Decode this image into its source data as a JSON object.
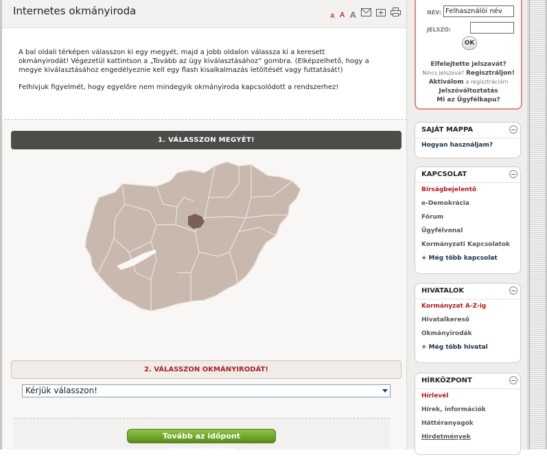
{
  "header": {
    "title": "Internetes okmányiroda",
    "tools": {
      "font_small": "A",
      "font_medium": "A",
      "font_large": "A"
    }
  },
  "intro": {
    "p1": "A bal oldali térképen válasszon ki egy megyét, majd a jobb oldalon válassza ki a keresett okmányirodát! Végezetül kattintson a „Tovább az ügy kiválasztásához” gombra. (Elképzelhető, hogy a megye kiválasztásához engedélyeznie kell egy flash kisalkalmazás letöltését vagy futtatását!)",
    "p2": "Felhívjuk figyelmét, hogy egyelőre nem mindegyik okmányiroda kapcsolódott a rendszerhez!"
  },
  "step1": "1. VÁLASSZON MEGYÉT!",
  "step2": "2. VÁLASSZON OKMÁNYIRODÁT!",
  "select": {
    "value": "Kérjük válasszon!"
  },
  "continue_button": "Tovább az időpont kiválasztásához",
  "colors": {
    "map_fill": "#c8b8ad",
    "map_selected": "#7a6055",
    "step1_bg": "#4e4c49",
    "accent_red": "#a62222",
    "button_green": "#6fa52b"
  },
  "login": {
    "name_label": "NÉV:",
    "name_value": "Felhasználói név",
    "password_label": "JELSZÓ:",
    "ok": "OK",
    "forgot": "Elfelejtette jelszavát?",
    "no_pass_prefix": "Nincs jelszava?",
    "register": "Regisztráljon!",
    "activate": "Aktiválom",
    "activate_suffix": "a regisztrációm",
    "change_pass": "Jelszóváltoztatás",
    "what_is": "Mi az Ügyfélkapu?"
  },
  "boxes": {
    "own_folder": {
      "title": "SAJÁT MAPPA",
      "items": [
        "Hogyan használjam?"
      ]
    },
    "contact": {
      "title": "KAPCSOLAT",
      "items": [
        "Bírságbejelentő",
        "e-Demokrácia",
        "Fórum",
        "Ügyfélvonal",
        "Kormányzati Kapcsolatok",
        "+ Még több kapcsolat"
      ]
    },
    "offices": {
      "title": "HIVATALOK",
      "items": [
        "Kormányzat A-Z-ig",
        "Hivatalkereső",
        "Okmányirodák",
        "+ Még több hivatal"
      ]
    },
    "news": {
      "title": "HÍRKÖZPONT",
      "items": [
        "Hírlevél",
        "Hírek, információk",
        "Háttéranyagok",
        "Hirdetmények"
      ]
    }
  }
}
